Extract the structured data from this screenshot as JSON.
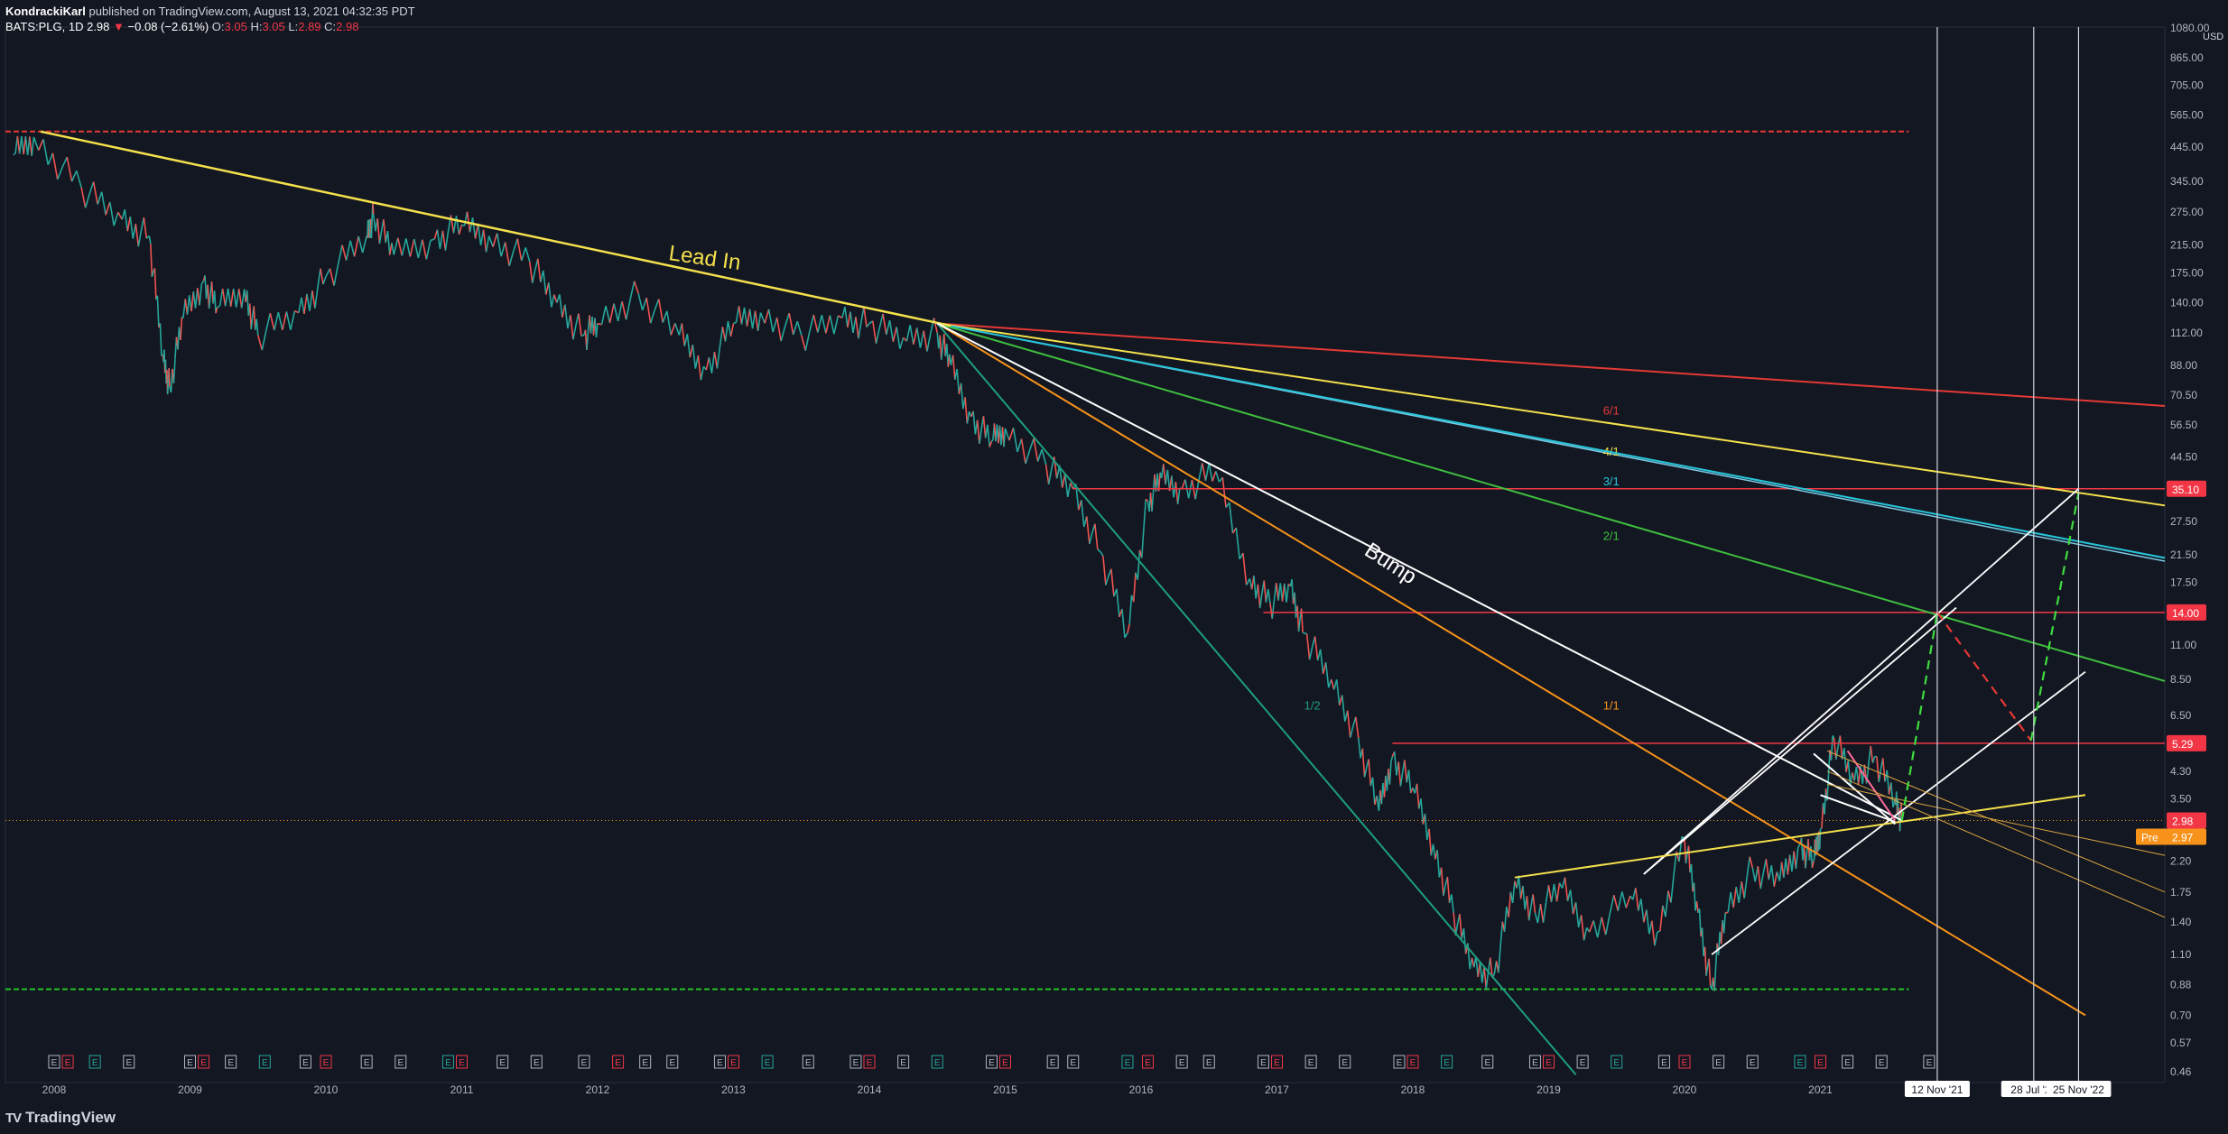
{
  "header": {
    "author": "KondrackiKarl",
    "published": "published on TradingView.com, August 13, 2021 04:32:35 PDT",
    "symbol": "BATS:PLG, 1D",
    "last": "2.98",
    "change_arrow": "▼",
    "change": "−0.08 (−2.61%)",
    "o_label": "O:",
    "o": "3.05",
    "h_label": "H:",
    "h": "3.05",
    "l_label": "L:",
    "l": "2.89",
    "c_label": "C:",
    "c": "2.98"
  },
  "footer": {
    "logo_mark": "TV",
    "logo_text": "TradingView"
  },
  "colors": {
    "background": "#131722",
    "candle_up": "#26a69a",
    "candle_down": "#ef5350",
    "lead_in": "#f5e14c",
    "fan_red": "#e53935",
    "fan_yellow": "#f5e14c",
    "fan_teal": "#26c6da",
    "fan_green": "#3fbf3f",
    "fan_half": "#1e9e7e",
    "support_green": "#21c32a",
    "orange": "#f7931a"
  },
  "chart_data": {
    "type": "line",
    "scale": "log",
    "currency": "USD",
    "y_ticks": [
      "1080.00",
      "865.00",
      "705.00",
      "565.00",
      "445.00",
      "345.00",
      "275.00",
      "215.00",
      "175.00",
      "140.00",
      "112.00",
      "88.00",
      "70.50",
      "56.50",
      "44.50",
      "35.10",
      "27.50",
      "21.50",
      "17.50",
      "14.00",
      "11.00",
      "8.50",
      "6.50",
      "5.29",
      "4.30",
      "3.50",
      "2.98",
      "2.20",
      "1.75",
      "1.40",
      "1.10",
      "0.88",
      "0.70",
      "0.57",
      "0.46"
    ],
    "y_tick_values": [
      1080,
      865,
      705,
      565,
      445,
      345,
      275,
      215,
      175,
      140,
      112,
      88,
      70.5,
      56.5,
      44.5,
      35.1,
      27.5,
      21.5,
      17.5,
      14,
      11,
      8.5,
      6.5,
      5.29,
      4.3,
      3.5,
      2.98,
      2.2,
      1.75,
      1.4,
      1.1,
      0.88,
      0.7,
      0.57,
      0.46
    ],
    "x_ticks": [
      "2008",
      "2009",
      "2010",
      "2011",
      "2012",
      "2013",
      "2014",
      "2015",
      "2016",
      "2017",
      "2018",
      "2019",
      "2020",
      "2021"
    ],
    "x_tick_values": [
      2008,
      2009,
      2010,
      2011,
      2012,
      2013,
      2014,
      2015,
      2016,
      2017,
      2018,
      2019,
      2020,
      2021
    ],
    "xlim": [
      2007.7,
      2023.0
    ],
    "ylim": [
      0.45,
      1100
    ],
    "price_series": {
      "x": [
        2007.7,
        2007.85,
        2008.2,
        2008.5,
        2008.7,
        2008.8,
        2008.85,
        2008.95,
        2009.1,
        2009.2,
        2009.4,
        2009.5,
        2009.8,
        2010.0,
        2010.3,
        2010.35,
        2010.5,
        2010.8,
        2011.0,
        2011.2,
        2011.5,
        2011.7,
        2011.9,
        2012.0,
        2012.3,
        2012.6,
        2012.8,
        2013.0,
        2013.2,
        2013.5,
        2013.8,
        2014.0,
        2014.25,
        2014.5,
        2014.6,
        2014.75,
        2014.9,
        2015.0,
        2015.3,
        2015.5,
        2015.7,
        2015.9,
        2016.05,
        2016.15,
        2016.3,
        2016.55,
        2016.8,
        2016.95,
        2017.1,
        2017.2,
        2017.4,
        2017.6,
        2017.75,
        2017.85,
        2018.0,
        2018.15,
        2018.3,
        2018.45,
        2018.6,
        2018.75,
        2018.9,
        2019.1,
        2019.3,
        2019.6,
        2019.8,
        2020.0,
        2020.1,
        2020.2,
        2020.3,
        2020.5,
        2020.7,
        2020.85,
        2020.95,
        2021.0,
        2021.1,
        2021.25,
        2021.4,
        2021.55,
        2021.6
      ],
      "y": [
        420,
        480,
        330,
        260,
        230,
        95,
        75,
        125,
        165,
        135,
        155,
        110,
        130,
        170,
        230,
        270,
        200,
        225,
        250,
        230,
        190,
        140,
        110,
        120,
        150,
        110,
        85,
        120,
        130,
        110,
        125,
        120,
        108,
        112,
        88,
        60,
        50,
        55,
        42,
        35,
        22,
        12,
        32,
        38,
        35,
        40,
        18,
        15,
        17,
        12,
        8.5,
        5.5,
        3.2,
        4.8,
        3.8,
        2.5,
        1.5,
        1.0,
        0.95,
        1.9,
        1.5,
        1.8,
        1.3,
        1.7,
        1.3,
        2.6,
        1.5,
        0.85,
        1.5,
        2.1,
        1.9,
        2.5,
        2.2,
        2.8,
        5.5,
        4.0,
        4.8,
        3.5,
        2.98
      ]
    },
    "resistance_lines": [
      35.1,
      14.0,
      5.29
    ],
    "support_dashed_top": 500,
    "support_dashed_bottom": 0.85,
    "last_price": 2.98,
    "pre_label": "Pre",
    "pre_price": "2.97",
    "fan_labels": [
      "6/1",
      "4/1",
      "3/1",
      "2/1",
      "1/1",
      "1/2"
    ],
    "annotations": [
      "Lead In",
      "Bump"
    ],
    "date_markers": [
      "12 Nov '21",
      "28 Jul '22",
      "25 Nov '22"
    ],
    "date_marker_values": [
      2021.86,
      2022.57,
      2022.9
    ],
    "event_badge": "E"
  }
}
